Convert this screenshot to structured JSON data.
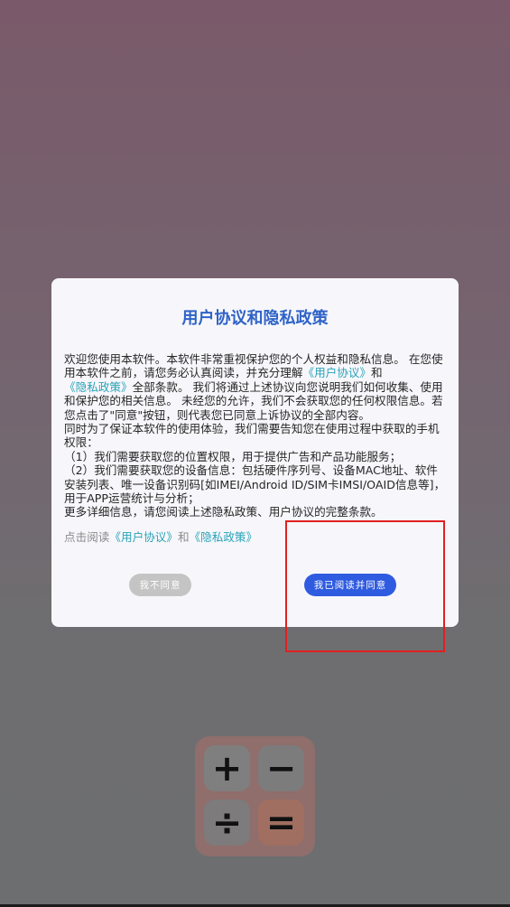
{
  "dialog": {
    "title": "用户协议和隐私政策",
    "body": {
      "intro_1": "欢迎您使用本软件。本软件非常重视保护您的个人权益和隐私信息。 在您使用本软件之前，请您务必认真阅读，并充分理解",
      "link_user_agreement": "《用户协议》",
      "and_1": "和",
      "link_privacy_policy": "《隐私政策》",
      "intro_2": "全部条款。 我们将通过上述协议向您说明我们如何收集、使用和保护您的相关信息。 未经您的允许，我们不会获取您的任何权限信息。若您点击了\"同意\"按钮，则代表您已同意上诉协议的全部内容。",
      "para_2": " 同时为了保证本软件的使用体验，我们需要告知您在使用过程中获取的手机权限：",
      "item_1": "（1）我们需要获取您的位置权限，用于提供广告和产品功能服务；",
      "item_2": "（2）我们需要获取您的设备信息：包括硬件序列号、设备MAC地址、软件安装列表、唯一设备识别码[如IMEI/Android ID/SIM卡IMSI/OAID信息等]，用于APP运营统计与分析；",
      "more": "更多详细信息，请您阅读上述隐私政策、用户协议的完整条款。"
    },
    "hint": {
      "prefix": "点击阅读",
      "link_user_agreement": "《用户协议》",
      "and": "和",
      "link_privacy_policy": "《隐私政策》"
    },
    "buttons": {
      "disagree": "我不同意",
      "agree": "我已阅读并同意"
    }
  },
  "app_icon": {
    "keys": {
      "plus": "+",
      "minus": "−",
      "divide": "÷",
      "equals": "="
    }
  },
  "colors": {
    "title": "#2f63c8",
    "link": "#2aa3b8",
    "agree_button": "#2f5be0",
    "disagree_button": "#c4c4c4",
    "highlight": "#e02020"
  }
}
